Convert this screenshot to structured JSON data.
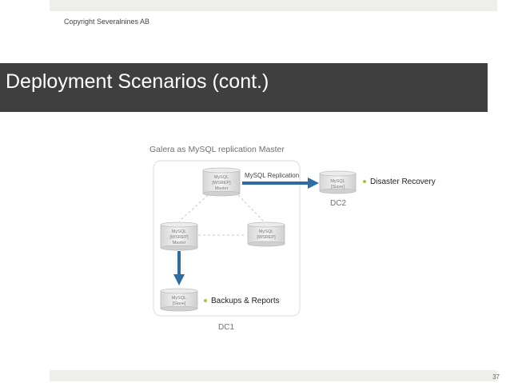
{
  "header": {
    "copyright": "Copyright Severalnines AB"
  },
  "slide": {
    "title": "Deployment Scenarios (cont.)",
    "page_number": "37"
  },
  "diagram": {
    "caption": "Galera as MySQL replication Master",
    "dc1_label": "DC1",
    "dc2_label": "DC2",
    "replication_label": "MySQL Replication",
    "nodes": {
      "top_master": [
        "MySQL",
        "[WSREP]",
        "Master"
      ],
      "left_master": [
        "MySQL",
        "[WSREP]",
        "Master"
      ],
      "right_wsrep": [
        "MySQL",
        "[WSREP]"
      ],
      "dc1_slave": [
        "MySQL",
        "[Slave]"
      ],
      "dc2_slave": [
        "MySQL",
        "[Slave]"
      ]
    },
    "bullets": {
      "disaster_recovery": "Disaster Recovery",
      "backups_reports": "Backups & Reports"
    },
    "colors": {
      "arrow": "#2e6ca4",
      "bullet": "#a9c23f"
    }
  }
}
